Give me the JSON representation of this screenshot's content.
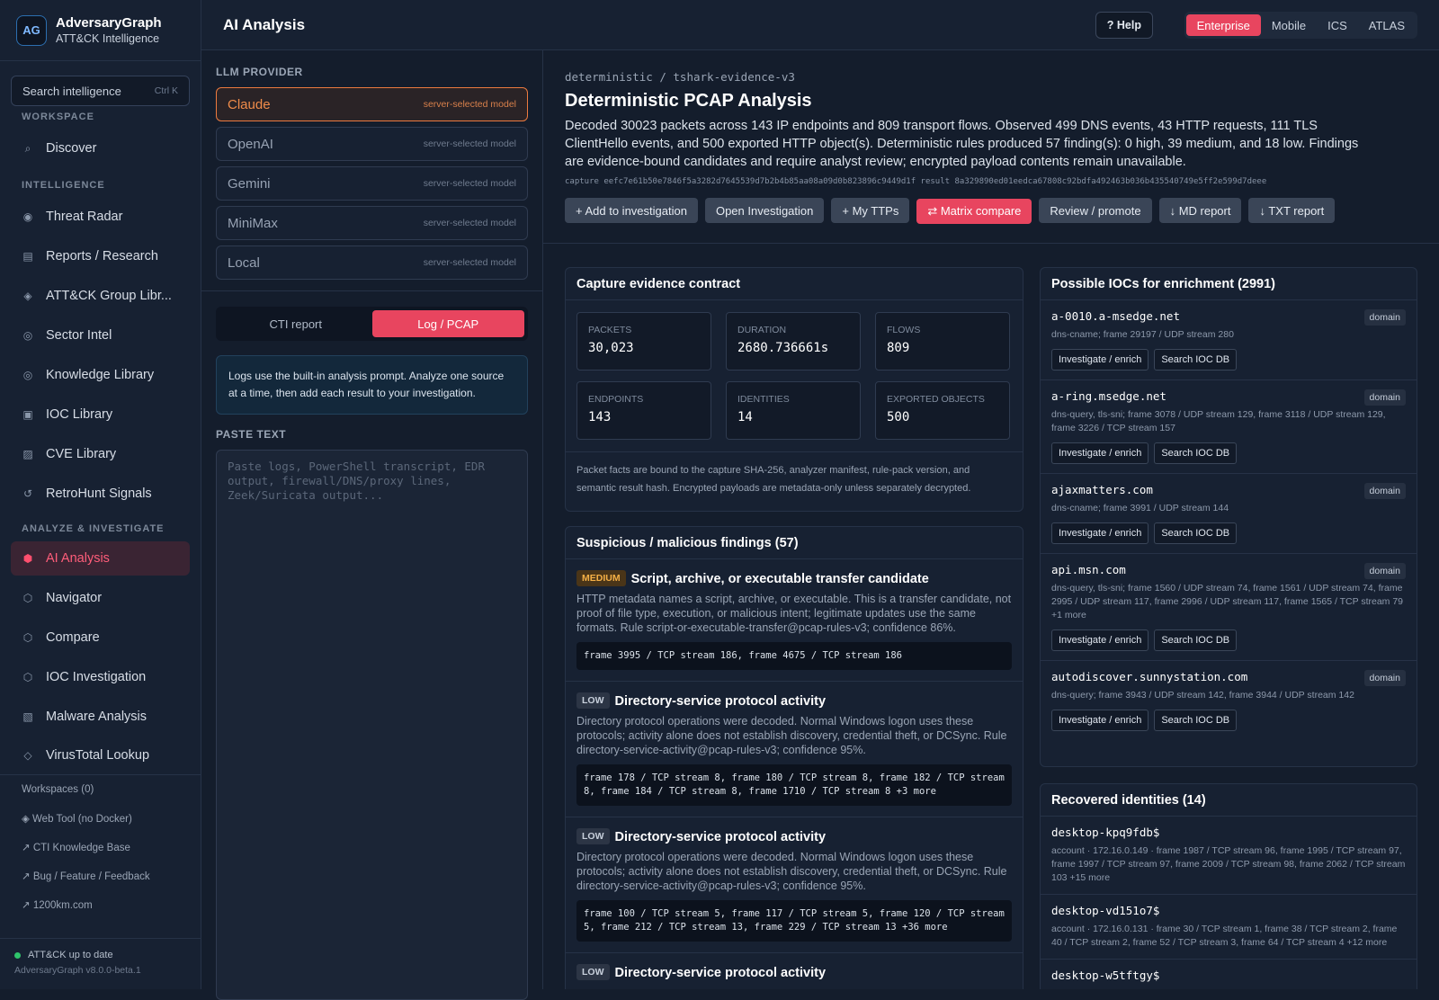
{
  "brand": {
    "name": "AdversaryGraph",
    "subtitle": "ATT&CK Intelligence",
    "logo_text": "AG"
  },
  "search": {
    "label": "Search intelligence",
    "shortcut": "Ctrl K"
  },
  "sidebar": {
    "sections": {
      "workspace": "WORKSPACE",
      "intelligence": "INTELLIGENCE",
      "analyze": "ANALYZE & INVESTIGATE"
    },
    "workspace_items": [
      {
        "label": "Discover",
        "icon": "search-icon"
      }
    ],
    "intelligence_items": [
      {
        "label": "Threat Radar",
        "icon": "radar-icon"
      },
      {
        "label": "Reports / Research",
        "icon": "document-icon"
      },
      {
        "label": "ATT&CK Group Libr...",
        "icon": "diamond-icon"
      },
      {
        "label": "Sector Intel",
        "icon": "target-icon"
      },
      {
        "label": "Knowledge Library",
        "icon": "library-icon"
      },
      {
        "label": "IOC Library",
        "icon": "box-icon"
      },
      {
        "label": "CVE Library",
        "icon": "hatched-icon"
      },
      {
        "label": "RetroHunt Signals",
        "icon": "refresh-icon"
      }
    ],
    "analyze_items": [
      {
        "label": "AI Analysis",
        "icon": "hexagon-icon",
        "active": true
      },
      {
        "label": "Navigator",
        "icon": "hexagon-outline-icon"
      },
      {
        "label": "Compare",
        "icon": "hexagon-outline-icon"
      },
      {
        "label": "IOC Investigation",
        "icon": "hexagon-outline-icon"
      },
      {
        "label": "Malware Analysis",
        "icon": "hatched-icon"
      },
      {
        "label": "VirusTotal Lookup",
        "icon": "diamond-outline-icon"
      }
    ],
    "workspaces": "Workspaces (0)",
    "links": [
      "◈ Web Tool (no Docker)",
      "↗ CTI Knowledge Base",
      "↗ Bug / Feature / Feedback",
      "↗ 1200km.com"
    ],
    "status": "ATT&CK up to date",
    "version": "AdversaryGraph v8.0.0-beta.1"
  },
  "topbar": {
    "title": "AI Analysis",
    "help": "? Help",
    "domains": [
      {
        "label": "Enterprise",
        "active": true
      },
      {
        "label": "Mobile"
      },
      {
        "label": "ICS"
      },
      {
        "label": "ATLAS"
      }
    ]
  },
  "left_panel": {
    "provider_label": "LLM PROVIDER",
    "providers": [
      {
        "name": "Claude",
        "model": "server-selected model",
        "selected": true
      },
      {
        "name": "OpenAI",
        "model": "server-selected model"
      },
      {
        "name": "Gemini",
        "model": "server-selected model"
      },
      {
        "name": "MiniMax",
        "model": "server-selected model"
      },
      {
        "name": "Local",
        "model": "server-selected model"
      }
    ],
    "modes": [
      {
        "label": "CTI report"
      },
      {
        "label": "Log / PCAP",
        "active": true
      }
    ],
    "info": "Logs use the built-in analysis prompt. Analyze one source at a time, then add each result to your investigation.",
    "paste_label": "PASTE TEXT",
    "paste_placeholder": "Paste logs, PowerShell transcript, EDR output, firewall/DNS/proxy lines, Zeek/Suricata output..."
  },
  "analysis": {
    "breadcrumb": "deterministic / tshark-evidence-v3",
    "title": "Deterministic PCAP Analysis",
    "summary": "Decoded 30023 packets across 143 IP endpoints and 809 transport flows. Observed 499 DNS events, 43 HTTP requests, 111 TLS ClientHello events, and 500 exported HTTP object(s). Deterministic rules produced 57 finding(s): 0 high, 39 medium, and 18 low. Findings are evidence-bound candidates and require analyst review; encrypted payload contents remain unavailable.",
    "hashes": "capture eefc7e61b50e7846f5a3282d7645539d7b2b4b85aa08a09d0b823896c9449d1f  result 8a329890ed01eedca67808c92bdfa492463b036b435540749e5ff2e599d7deee",
    "actions": [
      {
        "label": "+ Add to investigation"
      },
      {
        "label": "Open Investigation"
      },
      {
        "label": "+ My TTPs"
      },
      {
        "label": "⇄ Matrix compare",
        "primary": true
      },
      {
        "label": "Review / promote"
      },
      {
        "label": "↓ MD report"
      },
      {
        "label": "↓ TXT report"
      }
    ]
  },
  "contract": {
    "title": "Capture evidence contract",
    "stats": [
      {
        "label": "PACKETS",
        "value": "30,023"
      },
      {
        "label": "DURATION",
        "value": "2680.736661s"
      },
      {
        "label": "FLOWS",
        "value": "809"
      },
      {
        "label": "ENDPOINTS",
        "value": "143"
      },
      {
        "label": "IDENTITIES",
        "value": "14"
      },
      {
        "label": "EXPORTED OBJECTS",
        "value": "500"
      }
    ],
    "note": "Packet facts are bound to the capture SHA-256, analyzer manifest, rule-pack version, and semantic result hash. Encrypted payloads are metadata-only unless separately decrypted."
  },
  "findings": {
    "title": "Suspicious / malicious findings (57)",
    "items": [
      {
        "severity": "MEDIUM",
        "title": "Script, archive, or executable transfer candidate",
        "desc": "HTTP metadata names a script, archive, or executable. This is a transfer candidate, not proof of file type, execution, or malicious intent; legitimate updates use the same formats. Rule script-or-executable-transfer@pcap-rules-v3; confidence 86%.",
        "evidence": "frame 3995 / TCP stream 186, frame 4675 / TCP stream 186"
      },
      {
        "severity": "LOW",
        "title": "Directory-service protocol activity",
        "desc": "Directory protocol operations were decoded. Normal Windows logon uses these protocols; activity alone does not establish discovery, credential theft, or DCSync. Rule directory-service-activity@pcap-rules-v3; confidence 95%.",
        "evidence": "frame 178 / TCP stream 8, frame 180 / TCP stream 8, frame 182 / TCP stream 8, frame 184 / TCP stream 8, frame 1710 / TCP stream 8 +3 more"
      },
      {
        "severity": "LOW",
        "title": "Directory-service protocol activity",
        "desc": "Directory protocol operations were decoded. Normal Windows logon uses these protocols; activity alone does not establish discovery, credential theft, or DCSync. Rule directory-service-activity@pcap-rules-v3; confidence 95%.",
        "evidence": "frame 100 / TCP stream 5, frame 117 / TCP stream 5, frame 120 / TCP stream 5, frame 212 / TCP stream 13, frame 229 / TCP stream 13 +36 more"
      },
      {
        "severity": "LOW",
        "title": "Directory-service protocol activity",
        "desc": "",
        "evidence": ""
      }
    ]
  },
  "iocs": {
    "title": "Possible IOCs for enrichment (2991)",
    "investigate_label": "Investigate / enrich",
    "search_label": "Search IOC DB",
    "items": [
      {
        "value": "a-0010.a-msedge.net",
        "type": "domain",
        "meta": "dns-cname; frame 29197 / UDP stream 280"
      },
      {
        "value": "a-ring.msedge.net",
        "type": "domain",
        "meta": "dns-query, tls-sni; frame 3078 / UDP stream 129, frame 3118 / UDP stream 129, frame 3226 / TCP stream 157"
      },
      {
        "value": "ajaxmatters.com",
        "type": "domain",
        "meta": "dns-cname; frame 3991 / UDP stream 144"
      },
      {
        "value": "api.msn.com",
        "type": "domain",
        "meta": "dns-query, tls-sni; frame 1560 / UDP stream 74, frame 1561 / UDP stream 74, frame 2995 / UDP stream 117, frame 2996 / UDP stream 117, frame 1565 / TCP stream 79 +1 more"
      },
      {
        "value": "autodiscover.sunnystation.com",
        "type": "domain",
        "meta": "dns-query; frame 3943 / UDP stream 142, frame 3944 / UDP stream 142"
      }
    ]
  },
  "identities": {
    "title": "Recovered identities (14)",
    "items": [
      {
        "value": "desktop-kpq9fdb$",
        "meta": "account · 172.16.0.149 · frame 1987 / TCP stream 96, frame 1995 / TCP stream 97, frame 1997 / TCP stream 97, frame 2009 / TCP stream 98, frame 2062 / TCP stream 103 +15 more"
      },
      {
        "value": "desktop-vd151o7$",
        "meta": "account · 172.16.0.131 · frame 30 / TCP stream 1, frame 38 / TCP stream 2, frame 40 / TCP stream 2, frame 52 / TCP stream 3, frame 64 / TCP stream 4 +12 more"
      },
      {
        "value": "desktop-w5tftgy$",
        "meta": ""
      }
    ]
  }
}
